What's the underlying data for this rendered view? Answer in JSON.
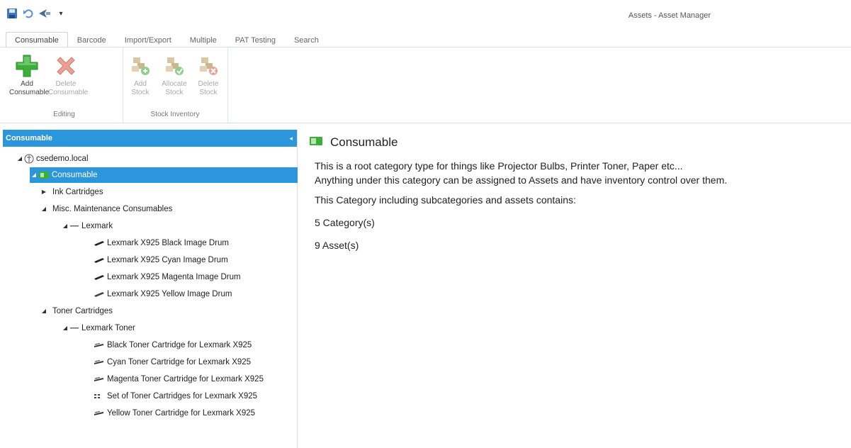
{
  "window": {
    "title": "Assets - Asset Manager"
  },
  "quick_access": {
    "icons": [
      "save-icon",
      "undo-icon",
      "send-icon",
      "customize-icon"
    ],
    "customize_glyph": "▾"
  },
  "tabs": [
    {
      "label": "Consumable",
      "active": true
    },
    {
      "label": "Barcode"
    },
    {
      "label": "Import/Export"
    },
    {
      "label": "Multiple"
    },
    {
      "label": "PAT Testing"
    },
    {
      "label": "Search"
    }
  ],
  "ribbon": {
    "editing": {
      "label": "Editing",
      "add": {
        "line1": "Add",
        "line2": "Consumable"
      },
      "delete": {
        "line1": "Delete",
        "line2": "Consumable"
      }
    },
    "stock": {
      "label": "Stock Inventory",
      "add": {
        "line1": "Add",
        "line2": "Stock"
      },
      "allocate": {
        "line1": "Allocate",
        "line2": "Stock"
      },
      "delete": {
        "line1": "Delete",
        "line2": "Stock"
      }
    }
  },
  "panel": {
    "title": "Consumable",
    "collapse_glyph": "◂"
  },
  "tree": {
    "nodes": [
      {
        "label": "csedemo.local",
        "expander": "◢"
      },
      {
        "label": "Consumable",
        "expander": "◢"
      },
      {
        "label": "Ink Cartridges",
        "expander": "▶"
      },
      {
        "label": "Misc. Maintenance Consumables",
        "expander": "◢"
      },
      {
        "label": "Lexmark",
        "expander": "◢"
      },
      {
        "label": "Lexmark X925 Black Image Drum"
      },
      {
        "label": "Lexmark X925 Cyan Image Drum"
      },
      {
        "label": "Lexmark X925 Magenta Image Drum"
      },
      {
        "label": "Lexmark X925 Yellow Image Drum"
      },
      {
        "label": "Toner Cartridges",
        "expander": "◢"
      },
      {
        "label": "Lexmark Toner",
        "expander": "◢"
      },
      {
        "label": "Black Toner Cartridge for Lexmark X925"
      },
      {
        "label": "Cyan Toner Cartridge for Lexmark X925"
      },
      {
        "label": "Magenta Toner Cartridge for Lexmark X925"
      },
      {
        "label": "Set of Toner Cartridges for Lexmark X925"
      },
      {
        "label": "Yellow Toner Cartridge for Lexmark X925"
      }
    ]
  },
  "content": {
    "title": "Consumable",
    "description_line1": "This is a root category type for things like Projector Bulbs, Printer Toner, Paper etc...",
    "description_line2": "Anything under this category can be assigned to Assets and have inventory control over them.",
    "contains_text": "This Category including subcategories and assets contains:",
    "category_count": "5 Category(s)",
    "asset_count": "9 Asset(s)"
  },
  "colors": {
    "accent": "#2c96dd",
    "add_green": "#3cae3a",
    "delete_red": "#e06a55"
  }
}
